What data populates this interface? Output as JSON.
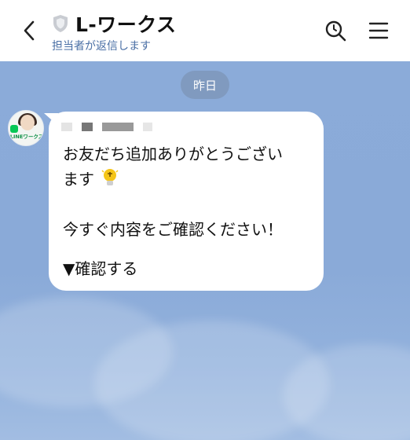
{
  "header": {
    "title": "L-ワークス",
    "subtitle": "担当者が返信します"
  },
  "chat": {
    "date_label": "昨日",
    "avatar_label": "LINEワークス",
    "message": {
      "line1": "お友だち追加ありがとうござい",
      "line2": "ます",
      "line3": "今すぐ内容をご確認ください！",
      "line4": "▼確認する"
    }
  },
  "colors": {
    "chat_background": "#8aaad9",
    "header_background": "#ffffff",
    "subtitle": "#4a6fa5",
    "line_green": "#06c755"
  },
  "icons": [
    "back-icon",
    "shield-icon",
    "search-icon",
    "menu-icon",
    "lightbulb-emoji"
  ]
}
